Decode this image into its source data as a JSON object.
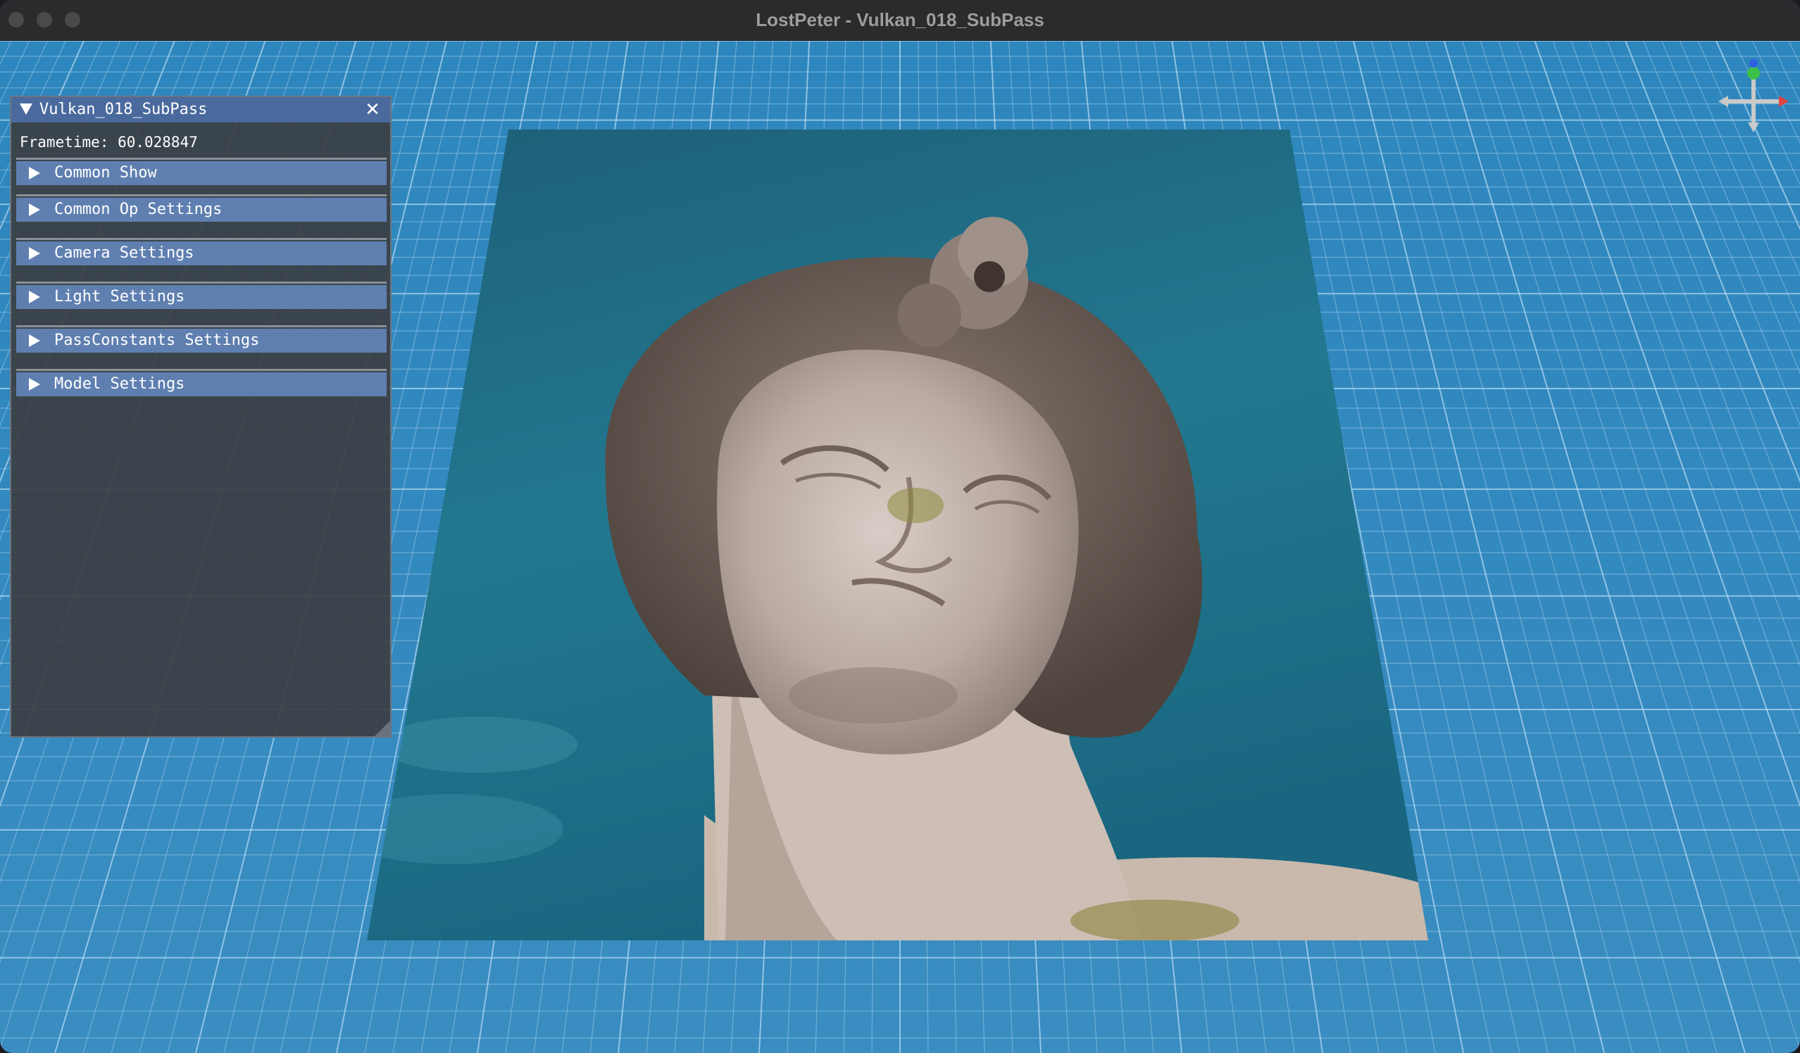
{
  "window": {
    "title": "LostPeter - Vulkan_018_SubPass"
  },
  "panel": {
    "title": "Vulkan_018_SubPass",
    "close_glyph": "✕",
    "frametime": "Frametime: 60.028847",
    "sections": [
      {
        "label": "Common Show"
      },
      {
        "label": "Common Op Settings"
      },
      {
        "label": "Camera Settings"
      },
      {
        "label": "Light Settings"
      },
      {
        "label": "PassConstants Settings"
      },
      {
        "label": "Model Settings"
      }
    ]
  },
  "scene": {
    "background_color": "#2d86bd",
    "grid_color": "#8fc3e4",
    "quad_sky_color": "#1f6f86",
    "gizmo_axes": [
      "x-red",
      "y-green",
      "z-blue"
    ]
  }
}
